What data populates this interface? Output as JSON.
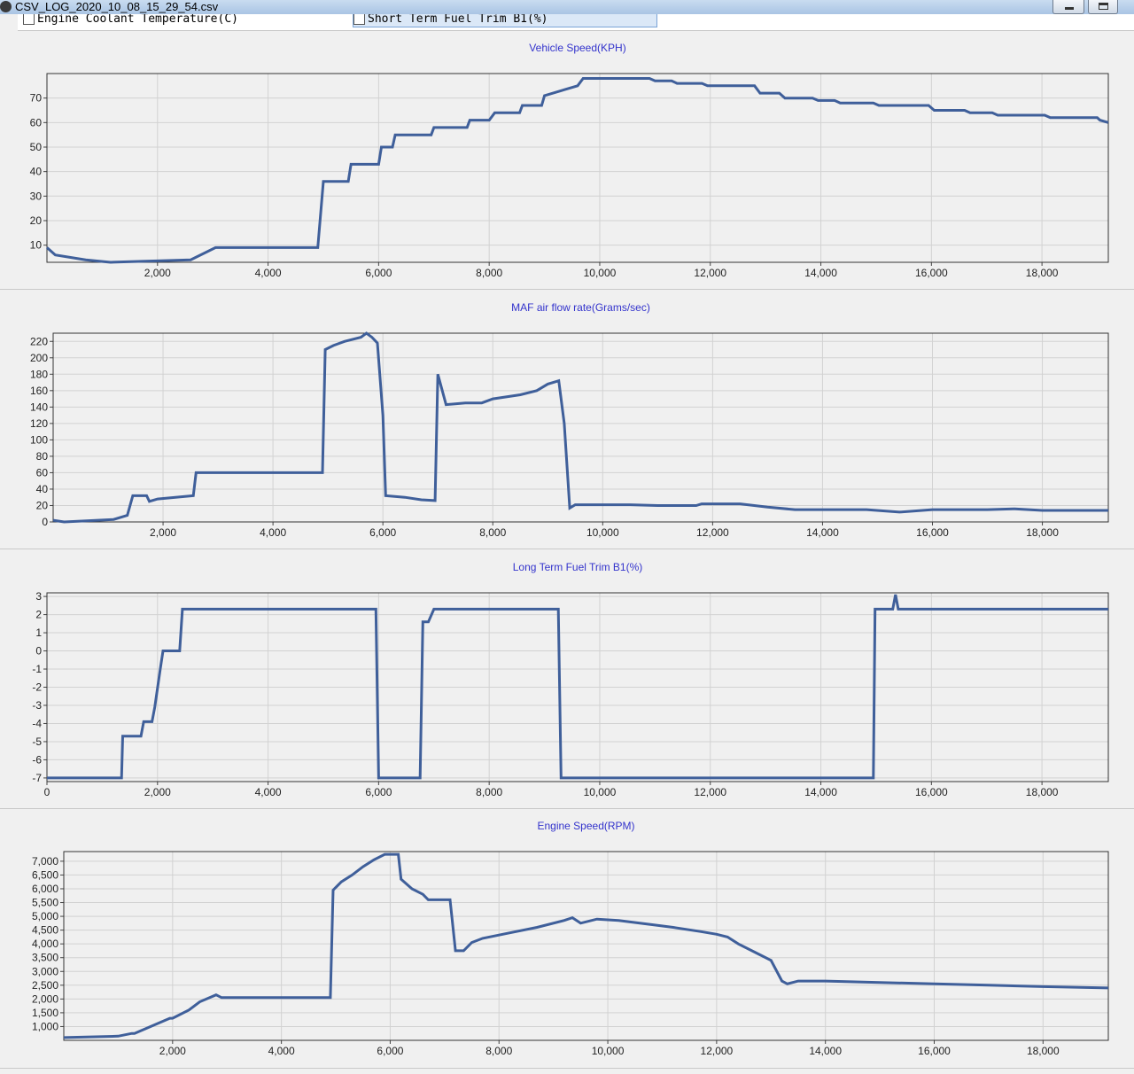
{
  "window": {
    "title": "CSV_LOG_2020_10_08_15_29_54.csv"
  },
  "checkbox_row": [
    {
      "label": "Engine Coolant Temperature(C)",
      "checked": false
    },
    {
      "label": "Short Term Fuel Trim B1(%)",
      "checked": false,
      "highlighted": true
    }
  ],
  "colors": {
    "series_line": "#3f5f9a",
    "title_text": "#3333cc",
    "plot_bg": "#f0f0f0",
    "grid": "#d2d2d2"
  },
  "chart_data": [
    {
      "type": "line",
      "title": "Vehicle Speed(KPH)",
      "xlabel": "",
      "ylabel": "",
      "xlim": [
        0,
        19200
      ],
      "ylim": [
        3,
        80
      ],
      "x_ticks": [
        "2,000",
        "4,000",
        "6,000",
        "8,000",
        "10,000",
        "12,000",
        "14,000",
        "16,000",
        "18,000"
      ],
      "y_ticks": [
        "10",
        "20",
        "30",
        "40",
        "50",
        "60",
        "70"
      ],
      "series": [
        {
          "x": [
            0,
            150,
            700,
            1150,
            2600,
            3050,
            3200,
            4900,
            5000,
            5450,
            5500,
            6000,
            6050,
            6250,
            6300,
            6950,
            7000,
            7600,
            7650,
            8000,
            8100,
            8550,
            8600,
            8950,
            9000,
            9600,
            9700,
            10900,
            11000,
            11300,
            11400,
            11850,
            11950,
            12800,
            12900,
            13250,
            13350,
            13850,
            13950,
            14250,
            14350,
            14950,
            15050,
            15950,
            16050,
            16600,
            16700,
            17100,
            17200,
            18050,
            18150,
            19000,
            19050,
            19200
          ],
          "y": [
            9,
            6,
            4,
            3,
            4,
            9,
            9,
            9,
            36,
            36,
            43,
            43,
            50,
            50,
            55,
            55,
            58,
            58,
            61,
            61,
            64,
            64,
            67,
            67,
            71,
            75,
            78,
            78,
            77,
            77,
            76,
            76,
            75,
            75,
            72,
            72,
            70,
            70,
            69,
            69,
            68,
            68,
            67,
            67,
            65,
            65,
            64,
            64,
            63,
            63,
            62,
            62,
            61,
            60
          ]
        }
      ]
    },
    {
      "type": "line",
      "title": "MAF air flow rate(Grams/sec)",
      "xlabel": "",
      "ylabel": "",
      "xlim": [
        0,
        19200
      ],
      "ylim": [
        0,
        230
      ],
      "x_ticks": [
        "2,000",
        "4,000",
        "6,000",
        "8,000",
        "10,000",
        "12,000",
        "14,000",
        "16,000",
        "18,000"
      ],
      "y_ticks": [
        "0",
        "20",
        "40",
        "60",
        "80",
        "100",
        "120",
        "140",
        "160",
        "180",
        "200",
        "220"
      ],
      "series": [
        {
          "x": [
            0,
            200,
            1100,
            1350,
            1450,
            1700,
            1750,
            1900,
            2550,
            2600,
            4900,
            4950,
            5100,
            5300,
            5600,
            5700,
            5800,
            5900,
            6000,
            6050,
            6400,
            6700,
            6950,
            7000,
            7150,
            7500,
            7800,
            8000,
            8500,
            8800,
            9000,
            9200,
            9300,
            9400,
            9500,
            10500,
            11000,
            11700,
            11800,
            12500,
            13000,
            13500,
            14000,
            14800,
            15400,
            16000,
            17000,
            17500,
            18000,
            19200
          ],
          "y": [
            2,
            0,
            3,
            8,
            32,
            32,
            25,
            28,
            32,
            60,
            60,
            210,
            215,
            220,
            225,
            230,
            225,
            218,
            130,
            32,
            30,
            27,
            26,
            180,
            143,
            145,
            145,
            150,
            155,
            160,
            168,
            172,
            120,
            17,
            21,
            21,
            20,
            20,
            22,
            22,
            18,
            15,
            15,
            15,
            12,
            15,
            15,
            16,
            14,
            14
          ]
        }
      ]
    },
    {
      "type": "line",
      "title": "Long Term Fuel Trim B1(%)",
      "xlabel": "",
      "ylabel": "",
      "xlim": [
        0,
        19200
      ],
      "ylim": [
        -7.2,
        3.2
      ],
      "x_ticks": [
        "0",
        "2,000",
        "4,000",
        "6,000",
        "8,000",
        "10,000",
        "12,000",
        "14,000",
        "16,000",
        "18,000"
      ],
      "y_ticks": [
        "3",
        "2",
        "1",
        "0",
        "-1",
        "-2",
        "-3",
        "-4",
        "-5",
        "-6",
        "-7"
      ],
      "series": [
        {
          "x": [
            0,
            1350,
            1370,
            1700,
            1750,
            1900,
            1950,
            2050,
            2100,
            2400,
            2450,
            5950,
            6000,
            6750,
            6800,
            6900,
            7000,
            9250,
            9300,
            14950,
            14980,
            15300,
            15350,
            15400,
            19200
          ],
          "y": [
            -7,
            -7,
            -4.7,
            -4.7,
            -3.9,
            -3.9,
            -3.1,
            -1,
            0,
            0,
            2.3,
            2.3,
            -7,
            -7,
            1.6,
            1.6,
            2.3,
            2.3,
            -7,
            -7,
            2.3,
            2.3,
            3.1,
            2.3,
            2.3
          ]
        }
      ]
    },
    {
      "type": "line",
      "title": "Engine Speed(RPM)",
      "xlabel": "",
      "ylabel": "",
      "xlim": [
        0,
        19200
      ],
      "ylim": [
        500,
        7350
      ],
      "x_ticks": [
        "2,000",
        "4,000",
        "6,000",
        "8,000",
        "10,000",
        "12,000",
        "14,000",
        "16,000",
        "18,000"
      ],
      "y_ticks": [
        "1,000",
        "1,500",
        "2,000",
        "2,500",
        "3,000",
        "3,500",
        "4,000",
        "4,500",
        "5,000",
        "5,500",
        "6,000",
        "6,500",
        "7,000"
      ],
      "series": [
        {
          "x": [
            0,
            1000,
            1250,
            1300,
            1950,
            2000,
            2300,
            2500,
            2800,
            2900,
            4900,
            4950,
            5100,
            5300,
            5500,
            5700,
            5900,
            6150,
            6200,
            6400,
            6600,
            6700,
            7100,
            7200,
            7350,
            7500,
            7700,
            8200,
            8700,
            9200,
            9350,
            9500,
            9800,
            10200,
            10800,
            11200,
            11700,
            12000,
            12200,
            12400,
            12700,
            13000,
            13200,
            13300,
            13500,
            14000,
            15000,
            16000,
            17000,
            18000,
            19200
          ],
          "y": [
            600,
            650,
            750,
            750,
            1300,
            1300,
            1600,
            1900,
            2150,
            2050,
            2050,
            5950,
            6250,
            6500,
            6800,
            7050,
            7250,
            7250,
            6350,
            6000,
            5800,
            5600,
            5600,
            3750,
            3750,
            4050,
            4200,
            4400,
            4600,
            4850,
            4950,
            4750,
            4900,
            4850,
            4700,
            4600,
            4450,
            4350,
            4250,
            4000,
            3700,
            3400,
            2650,
            2550,
            2650,
            2650,
            2600,
            2550,
            2500,
            2450,
            2400
          ]
        }
      ]
    }
  ]
}
